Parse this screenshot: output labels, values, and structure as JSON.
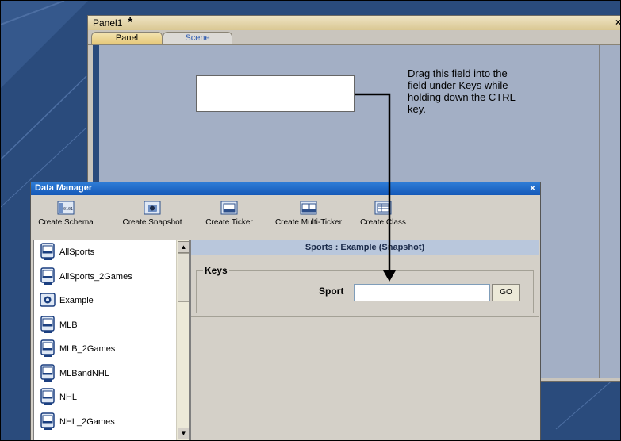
{
  "panel_window": {
    "title": "Panel1",
    "modified_marker": "*",
    "close_glyph": "×",
    "tabs": [
      "Panel",
      "Scene"
    ],
    "active_tab": "Panel"
  },
  "instruction": "Drag this field into the field under Keys while holding down the CTRL key.",
  "data_manager": {
    "title": "Data Manager",
    "close_glyph": "×",
    "toolbar": [
      {
        "label": "Create Schema",
        "icon": "schema-icon"
      },
      {
        "label": "Create Snapshot",
        "icon": "snapshot-icon"
      },
      {
        "label": "Create Ticker",
        "icon": "ticker-icon"
      },
      {
        "label": "Create Multi-Ticker",
        "icon": "multi-ticker-icon"
      },
      {
        "label": "Create Class",
        "icon": "class-icon"
      }
    ],
    "list_items": [
      {
        "label": "AllSports",
        "icon": "ticker-icon"
      },
      {
        "label": "AllSports_2Games",
        "icon": "ticker-icon"
      },
      {
        "label": "Example",
        "icon": "snapshot-icon"
      },
      {
        "label": "MLB",
        "icon": "ticker-icon"
      },
      {
        "label": "MLB_2Games",
        "icon": "ticker-icon"
      },
      {
        "label": "MLBandNHL",
        "icon": "ticker-icon"
      },
      {
        "label": "NHL",
        "icon": "ticker-icon"
      },
      {
        "label": "NHL_2Games",
        "icon": "ticker-icon"
      }
    ],
    "header": "Sports : Example (Snapshot)",
    "keys_group_label": "Keys",
    "sport_label": "Sport",
    "sport_value": "",
    "go_label": "GO"
  },
  "colors": {
    "desktop": "#2a4b7c",
    "canvas": "#a3afc5",
    "dm_titlebar": "#1458b8",
    "header_band": "#b9c7dc"
  }
}
